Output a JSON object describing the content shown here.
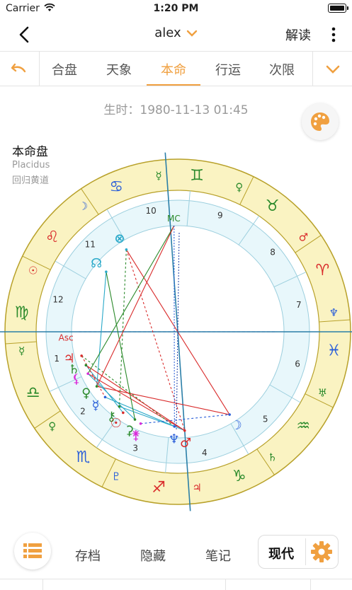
{
  "status": {
    "carrier": "Carrier",
    "time": "1:20 PM"
  },
  "nav": {
    "title": "alex",
    "chevron": "⌄",
    "action": "解读"
  },
  "tabs": [
    {
      "label": "合盘"
    },
    {
      "label": "天象"
    },
    {
      "label": "本命"
    },
    {
      "label": "行运"
    },
    {
      "label": "次限"
    }
  ],
  "active_tab": "本命",
  "birth": {
    "text": "生时：1980-11-13 01:45"
  },
  "chart": {
    "title": "本命盘",
    "system": "Placidus",
    "zodiac": "回归黄道"
  },
  "wheel": {
    "signs": [
      {
        "glyph": "♋",
        "color": "#2b5fd9"
      },
      {
        "glyph": "♌",
        "color": "#d92b2b"
      },
      {
        "glyph": "♍",
        "color": "#2b8a2b"
      },
      {
        "glyph": "♎",
        "color": "#2b8a2b"
      },
      {
        "glyph": "♏",
        "color": "#2b5fd9"
      },
      {
        "glyph": "♐",
        "color": "#d92b2b"
      },
      {
        "glyph": "♑",
        "color": "#2b8a2b"
      },
      {
        "glyph": "♒",
        "color": "#2b8a2b"
      },
      {
        "glyph": "♓",
        "color": "#2b5fd9"
      },
      {
        "glyph": "♈",
        "color": "#d92b2b"
      },
      {
        "glyph": "♉",
        "color": "#2b8a2b"
      },
      {
        "glyph": "♊",
        "color": "#2b8a2b"
      }
    ],
    "rulers": [
      {
        "glyph": "☽",
        "color": "#2b5fd9"
      },
      {
        "glyph": "☉",
        "color": "#d92b2b"
      },
      {
        "glyph": "☿",
        "color": "#2b8a2b"
      },
      {
        "glyph": "♀",
        "color": "#2b8a2b"
      },
      {
        "glyph": "♇",
        "color": "#2b5fd9"
      },
      {
        "glyph": "♃",
        "color": "#d92b2b"
      },
      {
        "glyph": "♄",
        "color": "#2b8a2b"
      },
      {
        "glyph": "♅",
        "color": "#2b8a2b"
      },
      {
        "glyph": "♆",
        "color": "#2b5fd9"
      },
      {
        "glyph": "♂",
        "color": "#d92b2b"
      },
      {
        "glyph": "♀",
        "color": "#2b8a2b"
      },
      {
        "glyph": "☿",
        "color": "#2b8a2b"
      }
    ],
    "houses": [
      "1",
      "2",
      "3",
      "4",
      "5",
      "6",
      "7",
      "8",
      "9",
      "10",
      "11",
      "12"
    ],
    "mc_label": "MC",
    "asc_label": "Asc",
    "planets": [
      {
        "glyph": "⊗",
        "color": "#2aa9c9"
      },
      {
        "glyph": "☊",
        "color": "#2aa9c9"
      },
      {
        "glyph": "♃",
        "color": "#d92b2b"
      },
      {
        "glyph": "♄",
        "color": "#2b8a2b"
      },
      {
        "glyph": "⚸",
        "color": "#d92bd9"
      },
      {
        "glyph": "♀",
        "color": "#2b8a2b"
      },
      {
        "glyph": "☿",
        "color": "#2b5fd9"
      },
      {
        "glyph": "⚷",
        "color": "#2b8a2b"
      },
      {
        "glyph": "☉",
        "color": "#d92b2b"
      },
      {
        "glyph": "⚳",
        "color": "#2b8a2b"
      },
      {
        "glyph": "⚵",
        "color": "#d92bd9"
      },
      {
        "glyph": "♆",
        "color": "#2b5fd9"
      },
      {
        "glyph": "♂",
        "color": "#d92b2b"
      },
      {
        "glyph": "☽",
        "color": "#2b5fd9"
      }
    ]
  },
  "bottom": {
    "archive": "存档",
    "hide": "隐藏",
    "notes": "笔记",
    "mode": "现代"
  },
  "colors": {
    "accent": "#f0a040",
    "ring": "#faf3c2",
    "inner": "#e8f7fb"
  }
}
